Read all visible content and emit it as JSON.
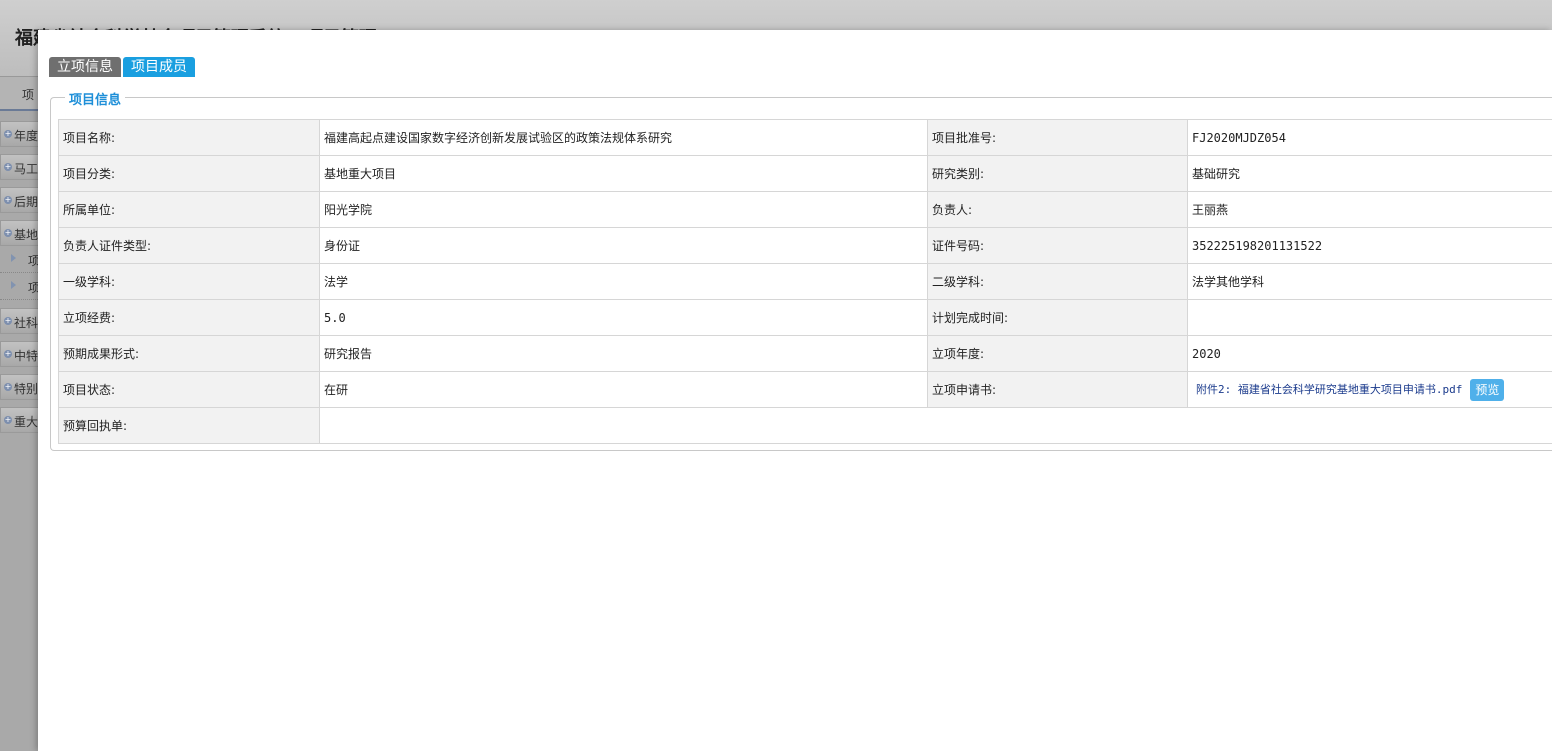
{
  "background": {
    "title": "福建省社会科学基金项目管理系统 - 项目管理",
    "tab_label": "项",
    "menu": [
      {
        "label": "年度"
      },
      {
        "label": "马工"
      },
      {
        "label": "后期"
      },
      {
        "label": "基地"
      }
    ],
    "submenu": [
      {
        "label": "项"
      },
      {
        "label": "项"
      }
    ],
    "menu2": [
      {
        "label": "社科"
      },
      {
        "label": "中特"
      },
      {
        "label": "特别"
      },
      {
        "label": "重大"
      }
    ]
  },
  "dialog": {
    "tabs": [
      {
        "label": "立项信息",
        "active": false
      },
      {
        "label": "项目成员",
        "active": true
      }
    ],
    "section_title": "项目信息",
    "rows": [
      {
        "l1": "项目名称:",
        "v1": "福建高起点建设国家数字经济创新发展试验区的政策法规体系研究",
        "l2": "项目批准号:",
        "v2": "FJ2020MJDZ054"
      },
      {
        "l1": "项目分类:",
        "v1": "基地重大项目",
        "l2": "研究类别:",
        "v2": "基础研究"
      },
      {
        "l1": "所属单位:",
        "v1": "阳光学院",
        "l2": "负责人:",
        "v2": "王丽燕"
      },
      {
        "l1": "负责人证件类型:",
        "v1": "身份证",
        "l2": "证件号码:",
        "v2": "352225198201131522"
      },
      {
        "l1": "一级学科:",
        "v1": "法学",
        "l2": "二级学科:",
        "v2": "法学其他学科"
      },
      {
        "l1": "立项经费:",
        "v1": "5.0",
        "l2": "计划完成时间:",
        "v2": ""
      },
      {
        "l1": "预期成果形式:",
        "v1": "研究报告",
        "l2": "立项年度:",
        "v2": "2020"
      },
      {
        "l1": "项目状态:",
        "v1": "在研",
        "l2": "立项申请书:",
        "v2": ""
      }
    ],
    "attachment": {
      "file_label": "附件2: 福建省社会科学研究基地重大项目申请书.pdf",
      "preview_label": "预览"
    },
    "last_row": {
      "label": "预算回执单:",
      "value": ""
    }
  },
  "colors": {
    "active_tab": "#1a9fe0",
    "inactive_tab": "#6f6f6f",
    "section_title": "#1e8fd8",
    "preview_button": "#4fb0ea",
    "attachment_link": "#1a3a8c"
  }
}
